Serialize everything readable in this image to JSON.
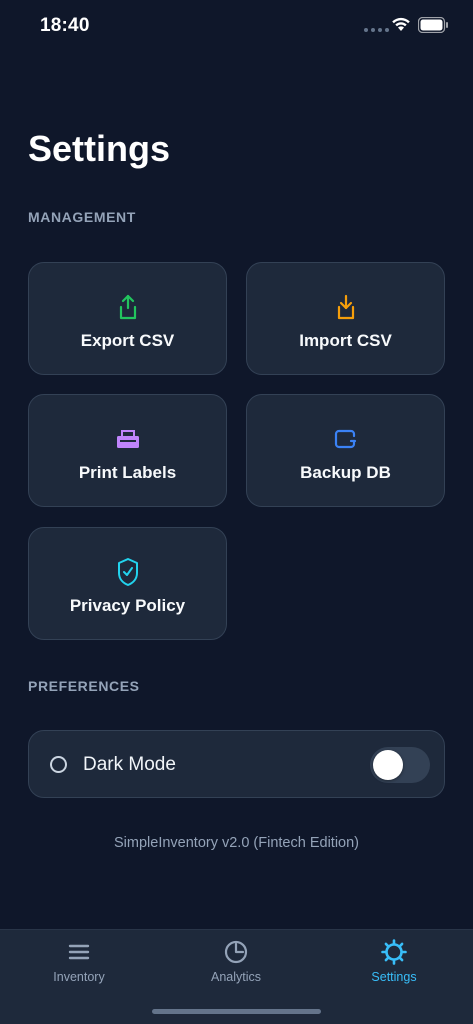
{
  "status_bar": {
    "time": "18:40"
  },
  "page": {
    "title": "Settings"
  },
  "management": {
    "section_label": "MANAGEMENT",
    "cards": [
      {
        "label": "Export CSV",
        "icon": "export-icon",
        "color": "#22c55e"
      },
      {
        "label": "Import CSV",
        "icon": "import-icon",
        "color": "#f59e0b"
      },
      {
        "label": "Print Labels",
        "icon": "printer-icon",
        "color": "#c084fc"
      },
      {
        "label": "Backup DB",
        "icon": "backup-icon",
        "color": "#3b82f6"
      },
      {
        "label": "Privacy Policy",
        "icon": "shield-check-icon",
        "color": "#22d3ee"
      }
    ]
  },
  "preferences": {
    "section_label": "PREFERENCES",
    "dark_mode_label": "Dark Mode",
    "dark_mode_enabled": false
  },
  "footer": {
    "version": "SimpleInventory v2.0 (Fintech Edition)"
  },
  "tab_bar": {
    "tabs": [
      {
        "label": "Inventory",
        "icon": "list-icon",
        "active": false
      },
      {
        "label": "Analytics",
        "icon": "pie-chart-icon",
        "active": false
      },
      {
        "label": "Settings",
        "icon": "gear-icon",
        "active": true
      }
    ],
    "active_color": "#38bdf8"
  }
}
